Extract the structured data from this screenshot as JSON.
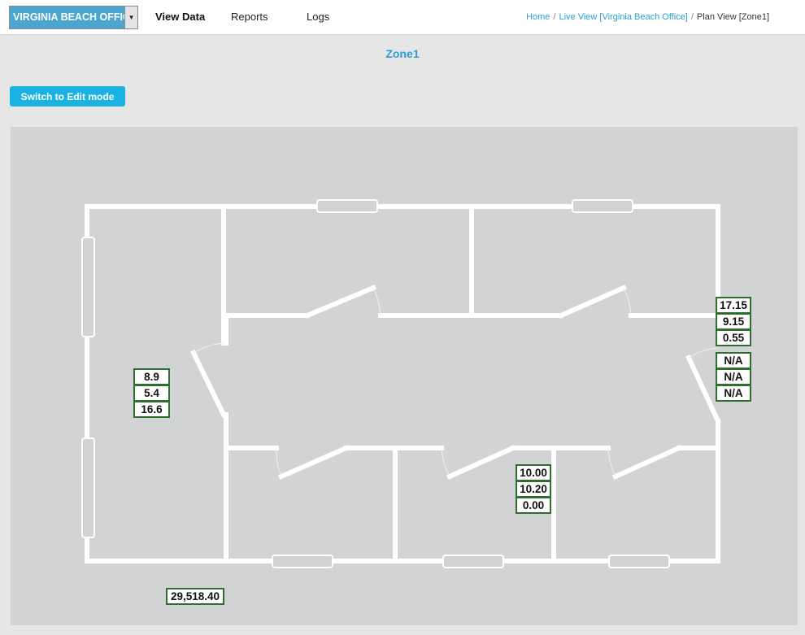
{
  "header": {
    "office_selector": {
      "label": "VIRGINIA BEACH OFFICE"
    },
    "nav": {
      "view_data": "View Data",
      "reports": "Reports",
      "logs": "Logs"
    },
    "breadcrumb": {
      "home": "Home",
      "live_view": "Live View [Virginia Beach Office]",
      "plan_view": "Plan View [Zone1]"
    }
  },
  "zone_title": "Zone1",
  "edit_button_label": "Switch to Edit mode",
  "sensors": {
    "left_room": [
      "8.9",
      "5.4",
      "16.6"
    ],
    "right_wall_upper": [
      "17.15",
      "9.15",
      "0.55"
    ],
    "right_wall_lower": [
      "N/A",
      "N/A",
      "N/A"
    ],
    "bottom_middle_room": [
      "10.00",
      "10.20",
      "0.00"
    ],
    "total": "29,518.40"
  },
  "colors": {
    "accent": "#2a9fd0",
    "button": "#1ab2e1",
    "sensor_border": "#2f6e2f",
    "office_selector": "#4aa6cf"
  }
}
